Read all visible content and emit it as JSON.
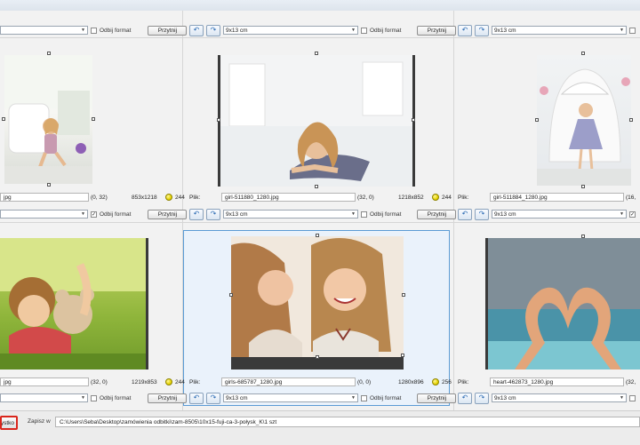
{
  "ui": {
    "fit_btn": "Przytnij",
    "mirror_label": "Odbij format",
    "file_label": "Plik:",
    "save_label": "Zapisz w",
    "all_btn": "ystko",
    "path": "C:\\Users\\Seba\\Desktop\\zamówienia odbitki\\zam-8505\\10x15-fuji-ca-3-połysk_K\\1 szt"
  },
  "panels": [
    {
      "format": "",
      "mirror_checked": false,
      "file": "",
      "pos": "",
      "size": "",
      "score": ""
    },
    {
      "format": "9x13 cm",
      "mirror_checked": false,
      "file": "",
      "pos": "",
      "size": "",
      "score": ""
    },
    {
      "format": "9x13 cm",
      "mirror_checked": false,
      "file": "",
      "pos": "",
      "size": "",
      "score": ""
    },
    {
      "format": "",
      "mirror_checked": true,
      "file": "jpg",
      "pos": "(0, 32)",
      "size": "853x1218",
      "score": "244"
    },
    {
      "format": "9x13 cm",
      "mirror_checked": false,
      "file": "girl-511880_1280.jpg",
      "pos": "(32, 0)",
      "size": "1218x852",
      "score": "244"
    },
    {
      "format": "9x13 cm",
      "mirror_checked": true,
      "file": "girl-511884_1280.jpg",
      "pos": "(16,",
      "size": "",
      "score": ""
    },
    {
      "format": "",
      "mirror_checked": false,
      "file": "jpg",
      "pos": "(32, 0)",
      "size": "1219x853",
      "score": "244"
    },
    {
      "format": "9x13 cm",
      "mirror_checked": false,
      "file": "girls-685787_1280.jpg",
      "pos": "(0, 0)",
      "size": "1280x896",
      "score": "256"
    },
    {
      "format": "9x13 cm",
      "mirror_checked": false,
      "file": "heart-462873_1280.jpg",
      "pos": "(32,",
      "size": "",
      "score": ""
    }
  ]
}
